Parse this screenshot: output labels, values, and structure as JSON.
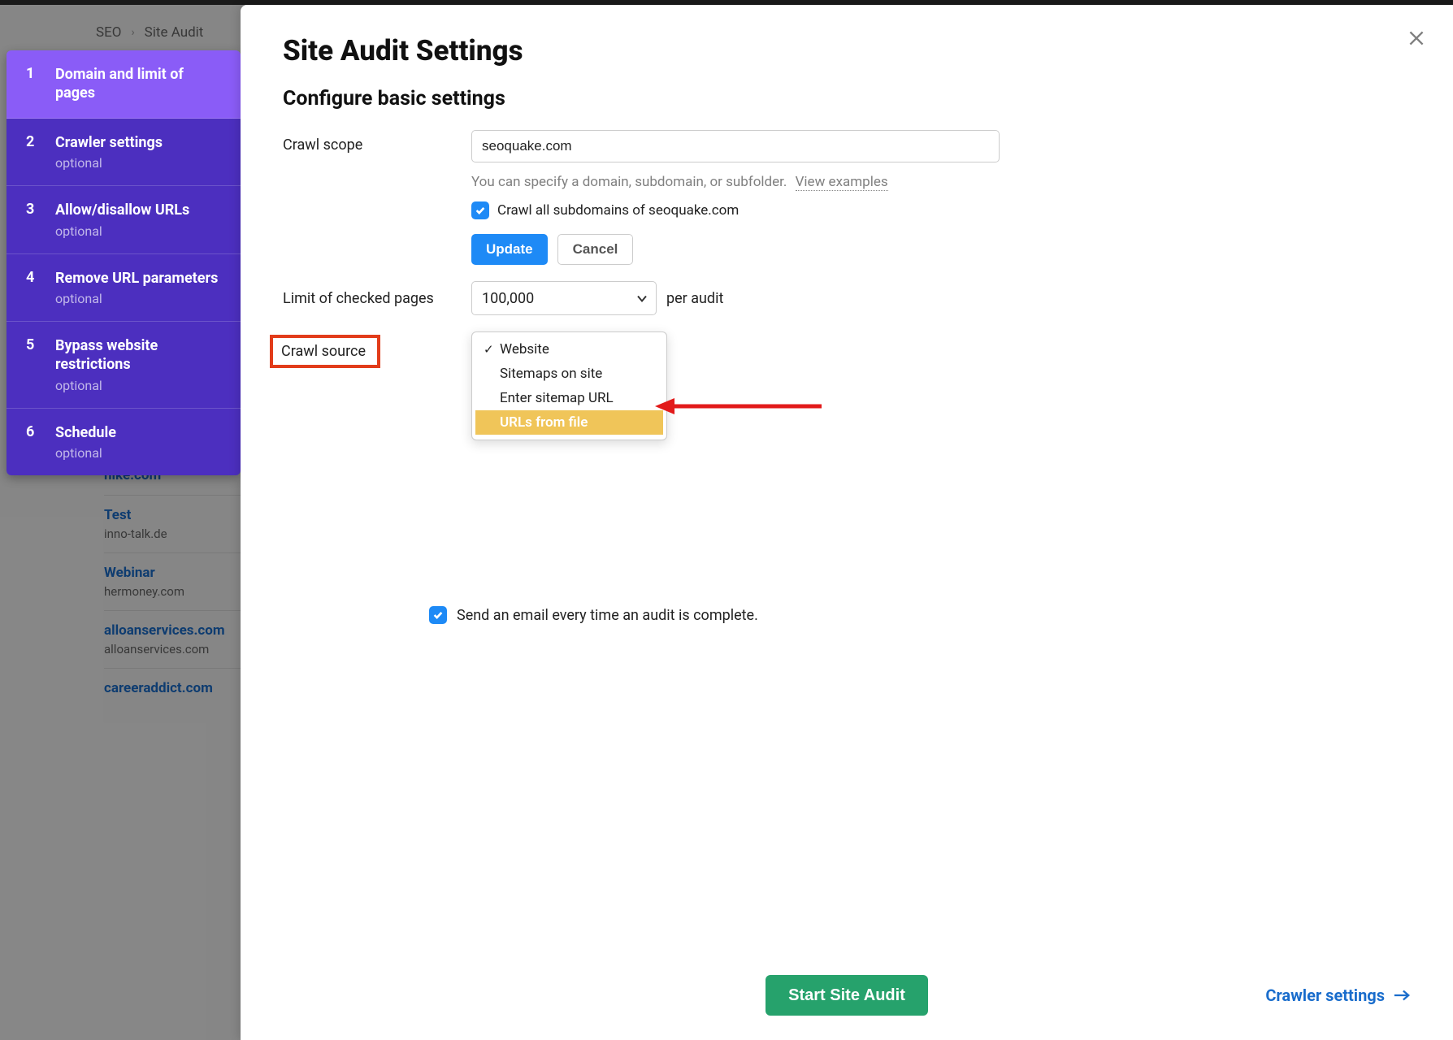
{
  "breadcrumb": {
    "root": "SEO",
    "current": "Site Audit"
  },
  "steps": [
    {
      "num": "1",
      "title": "Domain and limit of pages",
      "sub": ""
    },
    {
      "num": "2",
      "title": "Crawler settings",
      "sub": "optional"
    },
    {
      "num": "3",
      "title": "Allow/disallow URLs",
      "sub": "optional"
    },
    {
      "num": "4",
      "title": "Remove URL parameters",
      "sub": "optional"
    },
    {
      "num": "5",
      "title": "Bypass website restrictions",
      "sub": "optional"
    },
    {
      "num": "6",
      "title": "Schedule",
      "sub": "optional"
    }
  ],
  "bg_projects": [
    {
      "name": "nike.com",
      "domain": ""
    },
    {
      "name": "Test",
      "domain": "inno-talk.de"
    },
    {
      "name": "Webinar",
      "domain": "hermoney.com"
    },
    {
      "name": "alloanservices.com",
      "domain": "alloanservices.com"
    },
    {
      "name": "careeraddict.com",
      "domain": ""
    }
  ],
  "modal": {
    "title": "Site Audit Settings",
    "subtitle": "Configure basic settings",
    "crawl_scope_label": "Crawl scope",
    "crawl_scope_value": "seoquake.com",
    "crawl_scope_hint": "You can specify a domain, subdomain, or subfolder.",
    "view_examples": "View examples",
    "crawl_sub_label": "Crawl all subdomains of seoquake.com",
    "update_btn": "Update",
    "cancel_btn": "Cancel",
    "limit_label": "Limit of checked pages",
    "limit_value": "100,000",
    "limit_suffix": "per audit",
    "crawl_source_label": "Crawl source",
    "dd": {
      "website": "Website",
      "sitemaps": "Sitemaps on site",
      "enter_url": "Enter sitemap URL",
      "from_file": "URLs from file"
    },
    "email_label": "Send an email every time an audit is complete.",
    "start_btn": "Start Site Audit",
    "next_link": "Crawler settings"
  }
}
